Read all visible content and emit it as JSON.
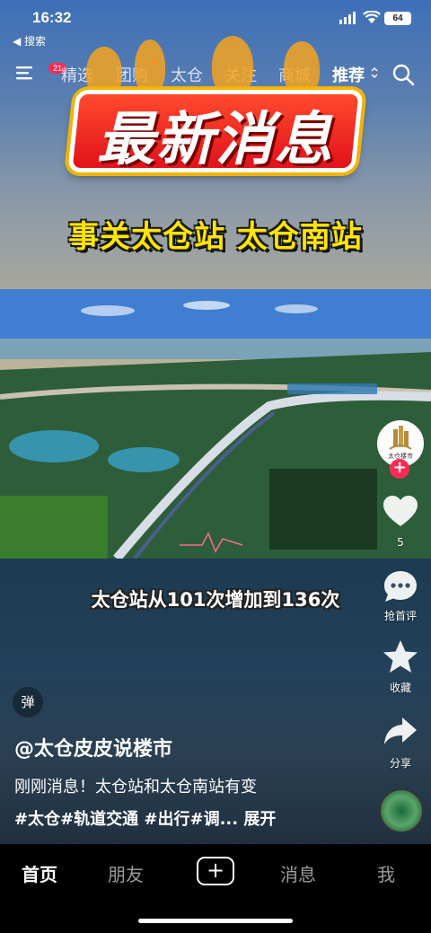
{
  "status_bar": {
    "time": "16:32",
    "back_label": "◀ 搜索",
    "battery": "64"
  },
  "top_nav": {
    "menu_badge": "21",
    "tabs": [
      {
        "label": "精选"
      },
      {
        "label": "团购"
      },
      {
        "label": "太仓"
      },
      {
        "label": "关注"
      },
      {
        "label": "商城"
      },
      {
        "label": "推荐"
      }
    ],
    "active_tab": "推荐",
    "accent_color": "#fe2c55"
  },
  "video": {
    "headline": "最新消息",
    "subhead": "事关太仓站  太仓南站",
    "caption": "太仓站从101次增加到136次"
  },
  "actions": {
    "avatar_text": "太仓楼市",
    "follow_label": "+",
    "like_count": "5",
    "comment_label": "抢首评",
    "favorite_label": "收藏",
    "share_label": "分享"
  },
  "info": {
    "danmu_label": "弹",
    "author": "@太仓皮皮说楼市",
    "description": "刚刚消息！太仓站和太仓南站有变",
    "tags": "#太仓#轨道交通 #出行#调... 展开"
  },
  "tab_bar": {
    "items": [
      {
        "label": "首页"
      },
      {
        "label": "朋友"
      },
      {
        "label": "+"
      },
      {
        "label": "消息"
      },
      {
        "label": "我"
      }
    ]
  },
  "icons": {
    "menu": "menu-icon",
    "search": "search-icon",
    "heart": "heart-icon",
    "comment": "comment-icon",
    "star": "star-icon",
    "share": "share-icon"
  }
}
